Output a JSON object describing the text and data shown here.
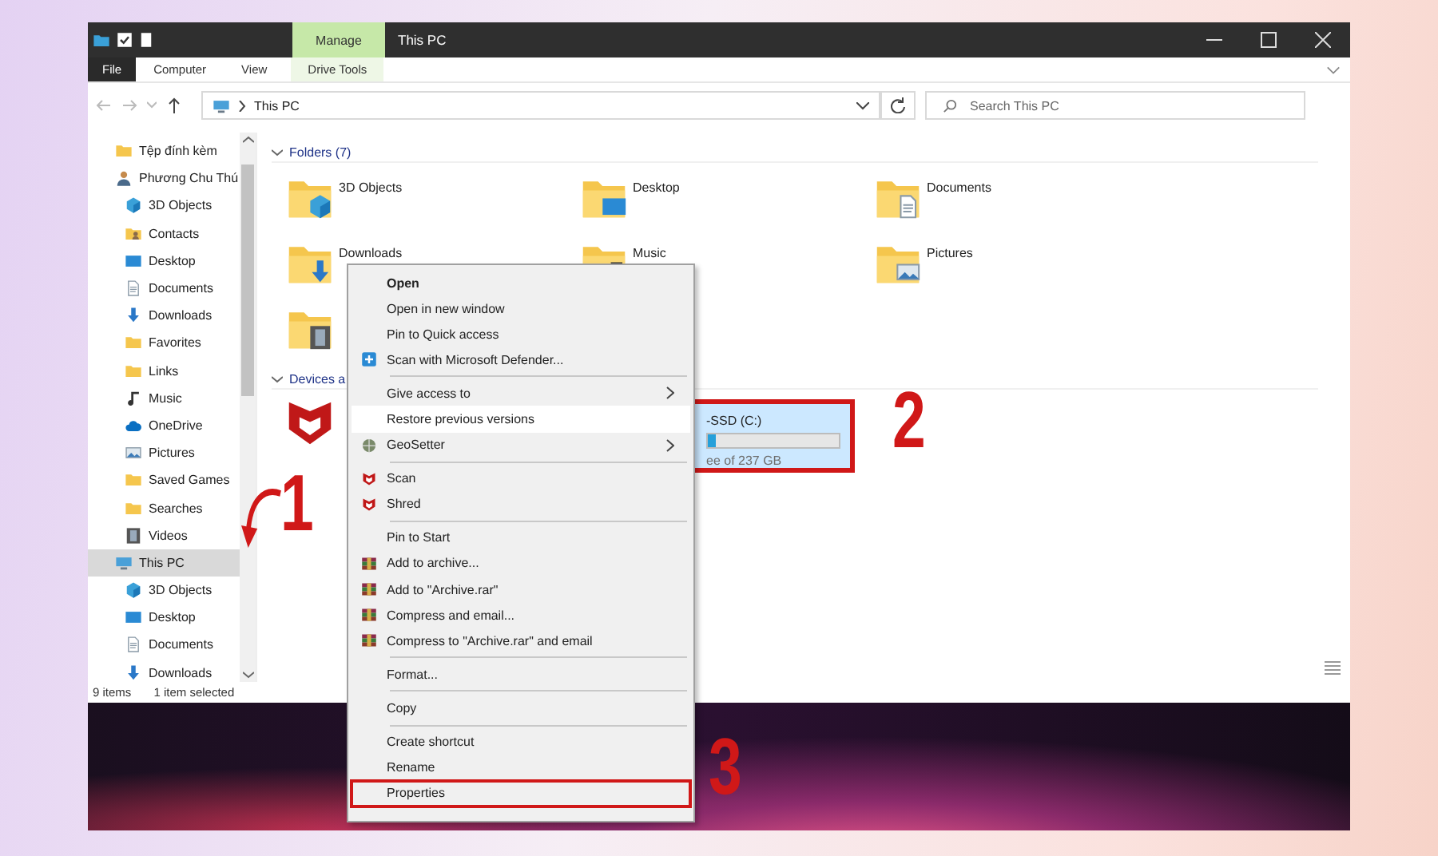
{
  "window": {
    "title": "This PC",
    "contextual_tab": "Manage"
  },
  "ribbon": {
    "tabs": [
      {
        "label": "File",
        "kind": "file"
      },
      {
        "label": "Computer",
        "kind": "plain"
      },
      {
        "label": "View",
        "kind": "plain"
      },
      {
        "label": "Drive Tools",
        "kind": "contextual"
      }
    ]
  },
  "address_bar": {
    "path": "This PC"
  },
  "search": {
    "placeholder": "Search This PC"
  },
  "sidebar": {
    "items": [
      {
        "label": "Tệp đính kèm",
        "kind": "folder",
        "selected": false
      },
      {
        "label": "Phương Chu Thú",
        "kind": "user",
        "selected": false,
        "children": [
          {
            "label": "3D Objects",
            "kind": "objects",
            "selected": false
          },
          {
            "label": "Contacts",
            "kind": "contacts",
            "selected": false
          },
          {
            "label": "Desktop",
            "kind": "desktop",
            "selected": false
          },
          {
            "label": "Documents",
            "kind": "documents",
            "selected": false
          },
          {
            "label": "Downloads",
            "kind": "downloads",
            "selected": false
          },
          {
            "label": "Favorites",
            "kind": "folder",
            "selected": false
          },
          {
            "label": "Links",
            "kind": "folder",
            "selected": false
          },
          {
            "label": "Music",
            "kind": "music",
            "selected": false
          },
          {
            "label": "OneDrive",
            "kind": "onedrive",
            "selected": false
          },
          {
            "label": "Pictures",
            "kind": "pictures",
            "selected": false
          },
          {
            "label": "Saved Games",
            "kind": "folder",
            "selected": false
          },
          {
            "label": "Searches",
            "kind": "folder",
            "selected": false
          },
          {
            "label": "Videos",
            "kind": "videos",
            "selected": false
          }
        ]
      },
      {
        "label": "This PC",
        "kind": "pc",
        "selected": true,
        "children": [
          {
            "label": "3D Objects",
            "kind": "objects",
            "selected": false
          },
          {
            "label": "Desktop",
            "kind": "desktop",
            "selected": false
          },
          {
            "label": "Documents",
            "kind": "documents",
            "selected": false
          },
          {
            "label": "Downloads",
            "kind": "downloads",
            "selected": false
          }
        ]
      }
    ]
  },
  "folders_section": {
    "title": "Folders (7)",
    "folders": [
      {
        "label": "3D Objects",
        "kind": "objects"
      },
      {
        "label": "Desktop",
        "kind": "desktop"
      },
      {
        "label": "Documents",
        "kind": "documents"
      },
      {
        "label": "Downloads",
        "kind": "downloads"
      },
      {
        "label": "Music",
        "kind": "music"
      },
      {
        "label": "Pictures",
        "kind": "pictures"
      },
      {
        "kind": "videos"
      }
    ]
  },
  "devices_section": {
    "title": "Devices a",
    "devices": [
      {
        "kind": "mcafee"
      },
      {
        "kind": "disk",
        "name": "-SSD (C:)",
        "free": "ee of 237 GB",
        "level": 0.06,
        "selected": true,
        "outlined": true
      }
    ]
  },
  "status_bar": {
    "count": "9 items",
    "selection": "1 item selected"
  },
  "context_menu": {
    "groups": [
      [
        {
          "label": "Open",
          "bold": true,
          "highlighted": false,
          "outlined": false
        },
        {
          "label": "Open in new window",
          "bold": false,
          "highlighted": false,
          "outlined": false
        },
        {
          "label": "Pin to Quick access",
          "bold": false,
          "highlighted": false,
          "outlined": false
        },
        {
          "label": "Scan with Microsoft Defender...",
          "kind": "defender",
          "bold": false,
          "highlighted": false,
          "outlined": false
        }
      ],
      [
        {
          "label": "Give access to",
          "submenu": true,
          "bold": false,
          "highlighted": false,
          "outlined": false
        },
        {
          "label": "Restore previous versions",
          "bold": false,
          "highlighted": true,
          "outlined": false
        },
        {
          "label": "GeoSetter",
          "kind": "geo",
          "submenu": true,
          "bold": false,
          "highlighted": false,
          "outlined": false
        }
      ],
      [
        {
          "label": "Scan",
          "kind": "mcafee",
          "bold": false,
          "highlighted": false,
          "outlined": false
        },
        {
          "label": "Shred",
          "kind": "mcafee",
          "bold": false,
          "highlighted": false,
          "outlined": false
        }
      ],
      [
        {
          "label": "Pin to Start",
          "bold": false,
          "highlighted": false,
          "outlined": false
        },
        {
          "label": "Add to archive...",
          "kind": "rar",
          "bold": false,
          "highlighted": false,
          "outlined": false
        },
        {
          "label": "Add to \"Archive.rar\"",
          "kind": "rar",
          "bold": false,
          "highlighted": false,
          "outlined": false
        },
        {
          "label": "Compress and email...",
          "kind": "rar",
          "bold": false,
          "highlighted": false,
          "outlined": false
        },
        {
          "label": "Compress to \"Archive.rar\" and email",
          "kind": "rar",
          "bold": false,
          "highlighted": false,
          "outlined": false
        }
      ],
      [
        {
          "label": "Format...",
          "bold": false,
          "highlighted": false,
          "outlined": false
        }
      ],
      [
        {
          "label": "Copy",
          "bold": false,
          "highlighted": false,
          "outlined": false
        }
      ],
      [
        {
          "label": "Create shortcut",
          "bold": false,
          "highlighted": false,
          "outlined": false
        },
        {
          "label": "Rename",
          "bold": false,
          "highlighted": false,
          "outlined": false
        },
        {
          "label": "Properties",
          "bold": false,
          "highlighted": false,
          "outlined": true
        }
      ]
    ]
  },
  "annotations": [
    {
      "label": "1"
    },
    {
      "label": "2"
    },
    {
      "label": "3"
    }
  ]
}
